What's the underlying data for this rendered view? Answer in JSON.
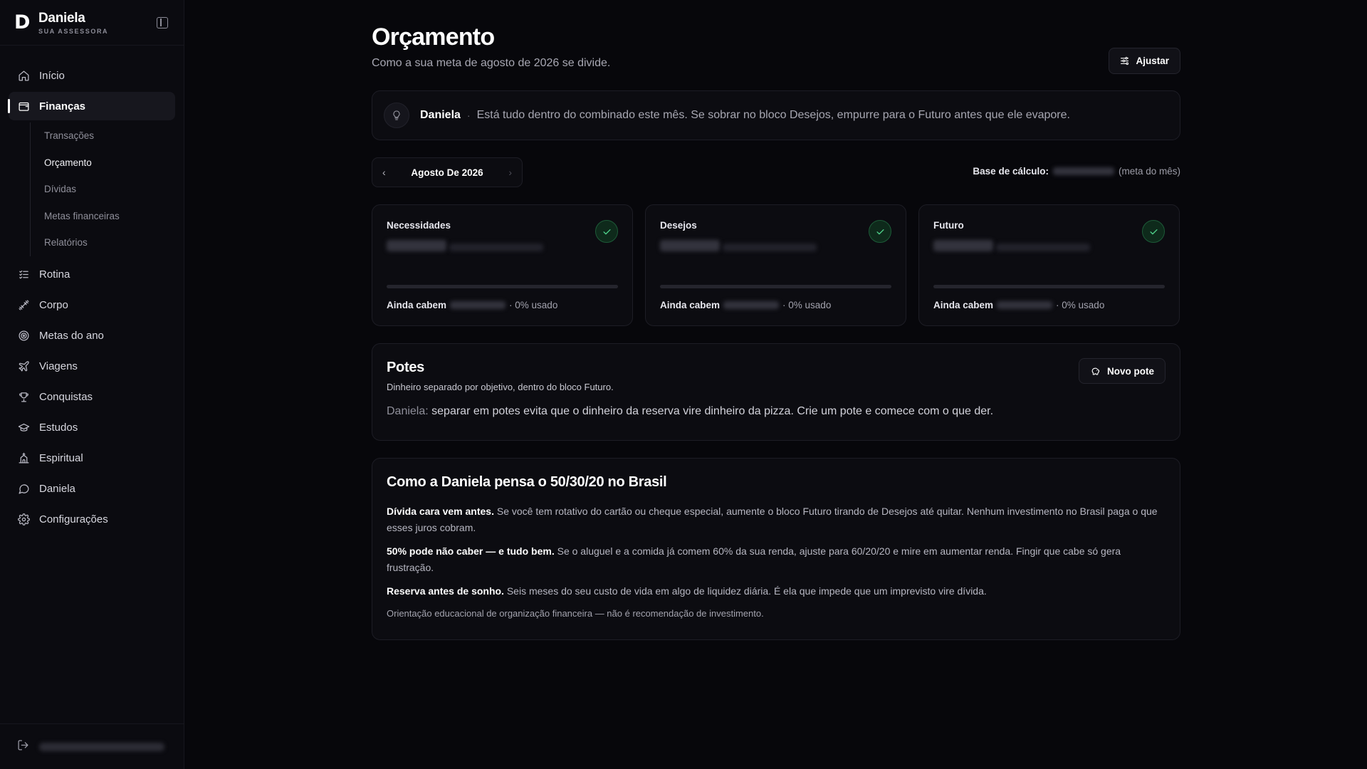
{
  "brand": {
    "logo": "D",
    "name": "Daniela",
    "subtitle": "SUA ASSESSORA"
  },
  "sidebar": {
    "items": [
      {
        "label": "Início",
        "icon": "home-icon"
      },
      {
        "label": "Finanças",
        "icon": "wallet-icon",
        "active": true
      },
      {
        "label": "Rotina",
        "icon": "checklist-icon"
      },
      {
        "label": "Corpo",
        "icon": "dumbbell-icon"
      },
      {
        "label": "Metas do ano",
        "icon": "target-icon"
      },
      {
        "label": "Viagens",
        "icon": "plane-icon"
      },
      {
        "label": "Conquistas",
        "icon": "trophy-icon"
      },
      {
        "label": "Estudos",
        "icon": "graduation-cap-icon"
      },
      {
        "label": "Espiritual",
        "icon": "church-icon"
      },
      {
        "label": "Daniela",
        "icon": "chat-bubble-icon"
      },
      {
        "label": "Configurações",
        "icon": "gear-icon"
      }
    ],
    "finance_sub": [
      {
        "label": "Transações"
      },
      {
        "label": "Orçamento",
        "active": true
      },
      {
        "label": "Dívidas"
      },
      {
        "label": "Metas financeiras"
      },
      {
        "label": "Relatórios"
      }
    ]
  },
  "header": {
    "title": "Orçamento",
    "subtitle": "Como a sua meta de agosto de 2026 se divide.",
    "adjust_label": "Ajustar"
  },
  "tip": {
    "name": "Daniela",
    "separator": "·",
    "text": "Está tudo dentro do combinado este mês. Se sobrar no bloco Desejos, empurre para o Futuro antes que ele evapore."
  },
  "month_nav": {
    "label": "Agosto De 2026",
    "prev": "‹",
    "next": "›"
  },
  "base_calc": {
    "label": "Base de cálculo:",
    "note": "(meta do mês)"
  },
  "cards": [
    {
      "title": "Necessidades",
      "remaining_label": "Ainda cabem",
      "usage": "· 0% usado",
      "used_fraction": 0
    },
    {
      "title": "Desejos",
      "remaining_label": "Ainda cabem",
      "usage": "· 0% usado",
      "used_fraction": 0
    },
    {
      "title": "Futuro",
      "remaining_label": "Ainda cabem",
      "usage": "· 0% usado",
      "used_fraction": 0
    }
  ],
  "potes": {
    "title": "Potes",
    "subtitle": "Dinheiro separado por objetivo, dentro do bloco Futuro.",
    "new_label": "Novo pote",
    "tip_who": "Daniela:",
    "tip_text": "separar em potes evita que o dinheiro da reserva vire dinheiro da pizza. Crie um pote e comece com o que der."
  },
  "guide": {
    "title": "Como a Daniela pensa o 50/30/20 no Brasil",
    "paragraphs": [
      {
        "bold": "Dívida cara vem antes.",
        "text": "Se você tem rotativo do cartão ou cheque especial, aumente o bloco Futuro tirando de Desejos até quitar. Nenhum investimento no Brasil paga o que esses juros cobram."
      },
      {
        "bold": "50% pode não caber — e tudo bem.",
        "text": "Se o aluguel e a comida já comem 60% da sua renda, ajuste para 60/20/20 e mire em aumentar renda. Fingir que cabe só gera frustração."
      },
      {
        "bold": "Reserva antes de sonho.",
        "text": "Seis meses do seu custo de vida em algo de liquidez diária. É ela que impede que um imprevisto vire dívida."
      }
    ],
    "disclaimer": "Orientação educacional de organização financeira — não é recomendação de investimento."
  },
  "colors": {
    "accent_green": "#4fd08a",
    "background": "#07070b",
    "surface": "#0c0c11"
  }
}
